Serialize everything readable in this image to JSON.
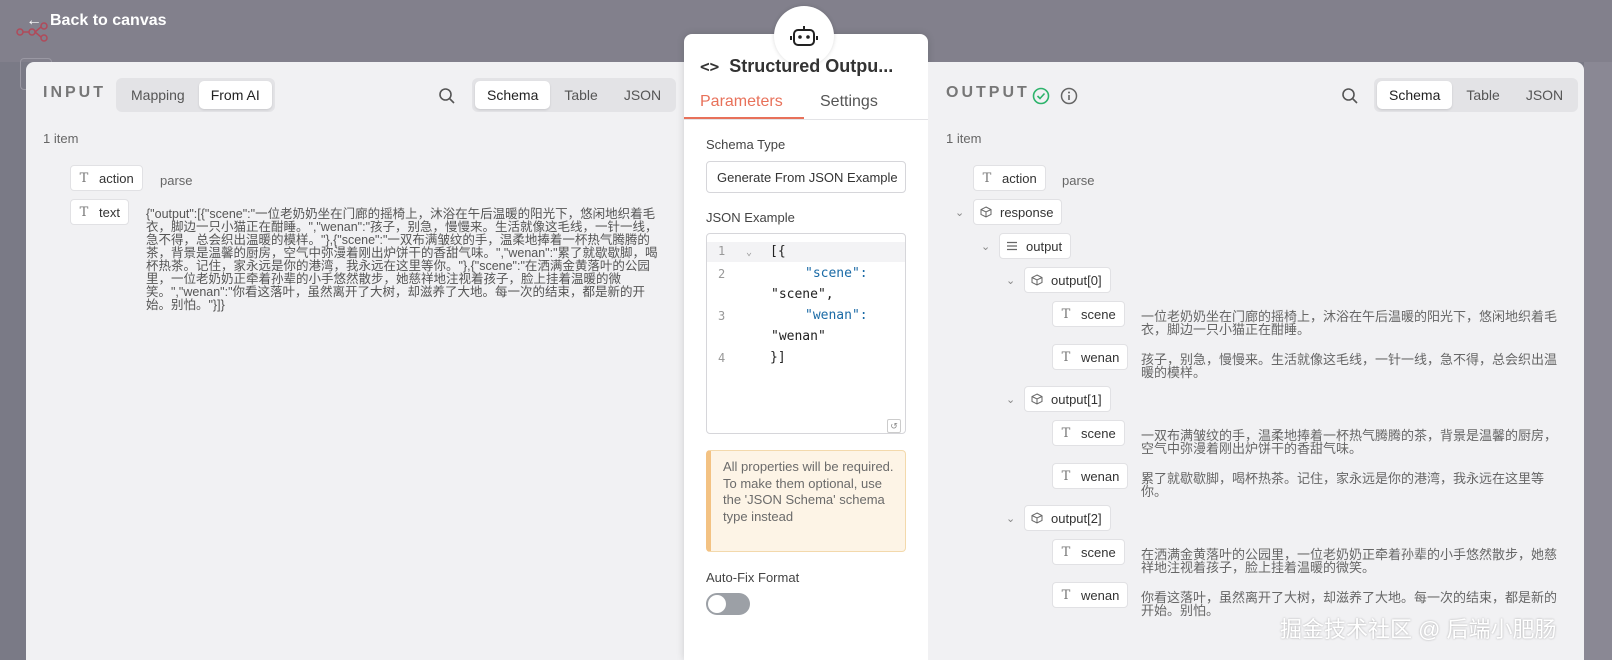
{
  "nav": {
    "back_label": "Back to canvas"
  },
  "input": {
    "title": "INPUT",
    "mode_tabs": [
      "Mapping",
      "From AI"
    ],
    "view_tabs": [
      "Schema",
      "Table",
      "JSON"
    ],
    "item_count": "1 item",
    "fields": [
      {
        "key": "action",
        "value": "parse"
      },
      {
        "key": "text",
        "value": "{\"output\":[{\"scene\":\"一位老奶奶坐在门廊的摇椅上，沐浴在午后温暖的阳光下，悠闲地织着毛衣，脚边一只小猫正在酣睡。\",\"wenan\":\"孩子，别急，慢慢来。生活就像这毛线，一针一线，急不得，总会织出温暖的模样。\"},{\"scene\":\"一双布满皱纹的手，温柔地捧着一杯热气腾腾的茶，背景是温馨的厨房，空气中弥漫着刚出炉饼干的香甜气味。\",\"wenan\":\"累了就歇歇脚，喝杯热茶。记住，家永远是你的港湾，我永远在这里等你。\"},{\"scene\":\"在洒满金黄落叶的公园里，一位老奶奶正牵着孙辈的小手悠然散步，她慈祥地注视着孩子，脸上挂着温暖的微笑。\",\"wenan\":\"你看这落叶，虽然离开了大树，却滋养了大地。每一次的结束，都是新的开始。别怕。\"}]}"
      }
    ]
  },
  "node": {
    "title": "Structured Outpu...",
    "tabs": [
      "Parameters",
      "Settings"
    ],
    "schema_type_label": "Schema Type",
    "schema_type_value": "Generate From JSON Example",
    "json_example_label": "JSON Example",
    "code_lines": [
      {
        "num": "1",
        "text": "[{"
      },
      {
        "num": "2",
        "text": "\"scene\":"
      },
      {
        "num": "",
        "text": "\"scene\","
      },
      {
        "num": "3",
        "text": "\"wenan\":"
      },
      {
        "num": "",
        "text": "\"wenan\""
      },
      {
        "num": "4",
        "text": "}]"
      }
    ],
    "notice": "All properties will be required. To make them optional, use the 'JSON Schema' schema type instead",
    "autofix_label": "Auto-Fix Format",
    "autofix_on": false
  },
  "output": {
    "title": "OUTPUT",
    "view_tabs": [
      "Schema",
      "Table",
      "JSON"
    ],
    "item_count": "1 item",
    "action": {
      "key": "action",
      "value": "parse"
    },
    "response_key": "response",
    "output_key": "output",
    "items": [
      {
        "key": "output[0]",
        "scene": "一位老奶奶坐在门廊的摇椅上，沐浴在午后温暖的阳光下，悠闲地织着毛衣，脚边一只小猫正在酣睡。",
        "wenan": "孩子，别急，慢慢来。生活就像这毛线，一针一线，急不得，总会织出温暖的模样。"
      },
      {
        "key": "output[1]",
        "scene": "一双布满皱纹的手，温柔地捧着一杯热气腾腾的茶，背景是温馨的厨房，空气中弥漫着刚出炉饼干的香甜气味。",
        "wenan": "累了就歇歇脚，喝杯热茶。记住，家永远是你的港湾，我永远在这里等你。"
      },
      {
        "key": "output[2]",
        "scene": "在洒满金黄落叶的公园里，一位老奶奶正牵着孙辈的小手悠然散步，她慈祥地注视着孩子，脸上挂着温暖的微笑。",
        "wenan": "你看这落叶，虽然离开了大树，却滋养了大地。每一次的结束，都是新的开始。别怕。"
      }
    ],
    "scene_key": "scene",
    "wenan_key": "wenan"
  },
  "watermark": "掘金技术社区 @ 后端小肥肠",
  "colors": {
    "accent": "#e8715a",
    "success": "#2db36b",
    "notice_bg": "#fdf4e6"
  }
}
